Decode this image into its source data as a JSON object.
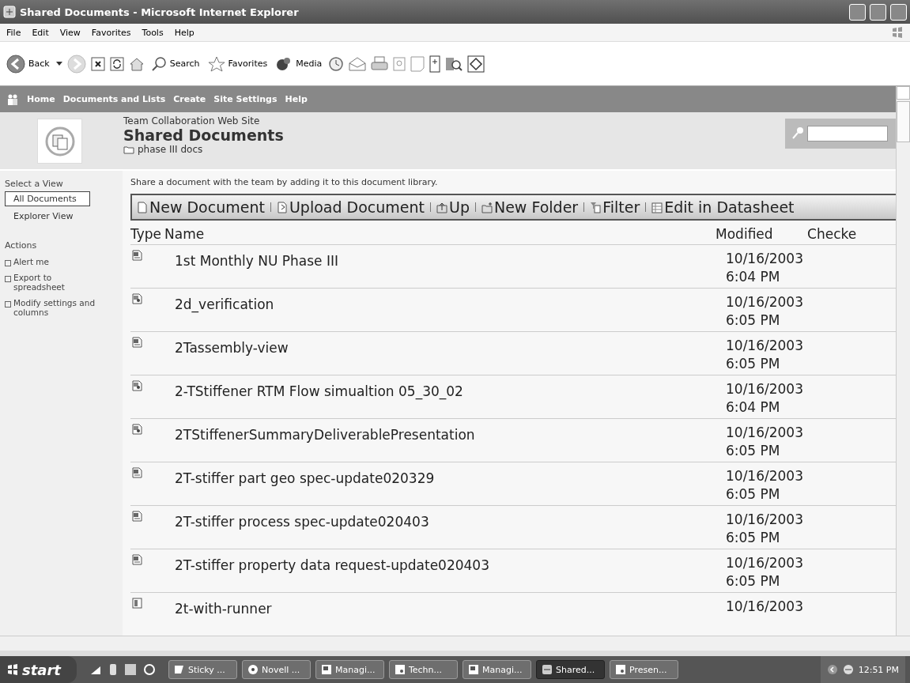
{
  "window": {
    "title": "Shared Documents - Microsoft Internet Explorer"
  },
  "menu": [
    "File",
    "Edit",
    "View",
    "Favorites",
    "Tools",
    "Help"
  ],
  "toolbar": [
    {
      "kind": "back",
      "label": "Back"
    },
    {
      "kind": "forward"
    },
    {
      "kind": "stop"
    },
    {
      "kind": "refresh"
    },
    {
      "kind": "home"
    },
    {
      "kind": "search",
      "label": "Search"
    },
    {
      "kind": "favorites",
      "label": "Favorites"
    },
    {
      "kind": "media",
      "label": "Media"
    },
    {
      "kind": "history"
    },
    {
      "kind": "mail"
    },
    {
      "kind": "print"
    },
    {
      "kind": "edit"
    },
    {
      "kind": "page"
    },
    {
      "kind": "messenger"
    },
    {
      "kind": "research"
    },
    {
      "kind": "diamond"
    }
  ],
  "site_nav": [
    "Home",
    "Documents and Lists",
    "Create",
    "Site Settings",
    "Help"
  ],
  "header": {
    "site": "Team Collaboration Web Site",
    "title": "Shared Documents",
    "folder": "phase III docs"
  },
  "sidebar": {
    "views_heading": "Select a View",
    "views": [
      {
        "label": "All Documents",
        "selected": true
      },
      {
        "label": "Explorer View",
        "selected": false
      }
    ],
    "actions_heading": "Actions",
    "actions": [
      "Alert me",
      "Export to spreadsheet",
      "Modify settings and columns"
    ]
  },
  "description": "Share a document with the team by adding it to this document library.",
  "commands": [
    {
      "kind": "new-document",
      "label": "New Document"
    },
    {
      "kind": "upload",
      "label": "Upload Document"
    },
    {
      "kind": "up",
      "label": "Up"
    },
    {
      "kind": "new-folder",
      "label": "New Folder"
    },
    {
      "kind": "filter",
      "label": "Filter"
    },
    {
      "kind": "datasheet",
      "label": "Edit in Datasheet"
    }
  ],
  "table": {
    "columns": [
      "Type",
      "Name",
      "Modified",
      "Checke"
    ],
    "rows": [
      {
        "kind": "word",
        "name": "1st Monthly NU Phase III",
        "date": "10/16/2003",
        "time": "6:04 PM"
      },
      {
        "kind": "ppt",
        "name": "2d_verification",
        "date": "10/16/2003",
        "time": "6:05 PM"
      },
      {
        "kind": "word",
        "name": "2Tassembly-view",
        "date": "10/16/2003",
        "time": "6:05 PM"
      },
      {
        "kind": "ppt",
        "name": "2-TStiffener RTM Flow simualtion 05_30_02",
        "date": "10/16/2003",
        "time": "6:04 PM"
      },
      {
        "kind": "ppt",
        "name": "2TStiffenerSummaryDeliverablePresentation",
        "date": "10/16/2003",
        "time": "6:05 PM"
      },
      {
        "kind": "word",
        "name": "2T-stiffer part geo spec-update020329",
        "date": "10/16/2003",
        "time": "6:05 PM"
      },
      {
        "kind": "word",
        "name": "2T-stiffer process spec-update020403",
        "date": "10/16/2003",
        "time": "6:05 PM"
      },
      {
        "kind": "word",
        "name": "2T-stiffer property data request-update020403",
        "date": "10/16/2003",
        "time": "6:05 PM"
      },
      {
        "kind": "other",
        "name": "2t-with-runner",
        "date": "10/16/2003"
      }
    ]
  },
  "taskbar": {
    "start": "start",
    "tasks": [
      {
        "kind": "note",
        "label": "Sticky ...",
        "selected": false
      },
      {
        "kind": "globe",
        "label": "Novell ...",
        "selected": false
      },
      {
        "kind": "word",
        "label": "Managi...",
        "selected": false
      },
      {
        "kind": "ppt",
        "label": "Techn...",
        "selected": false
      },
      {
        "kind": "word",
        "label": "Managi...",
        "selected": false
      },
      {
        "kind": "ie",
        "label": "Shared...",
        "selected": true
      },
      {
        "kind": "ppt",
        "label": "Presen...",
        "selected": false
      }
    ],
    "clock": "12:51 PM"
  }
}
